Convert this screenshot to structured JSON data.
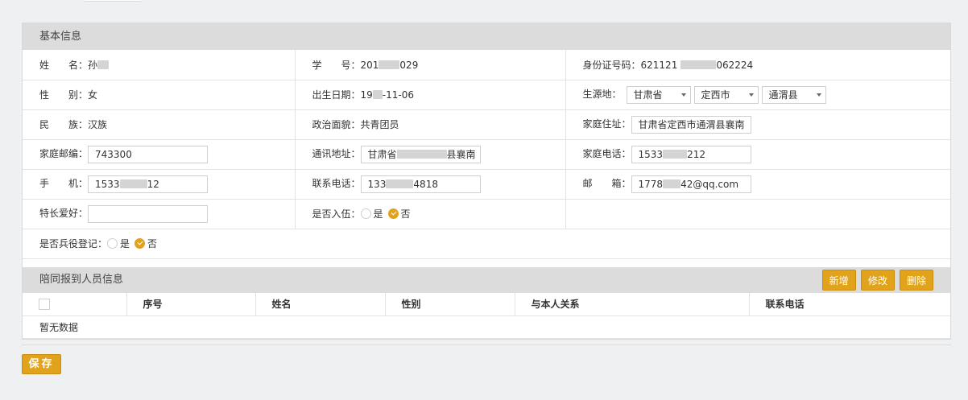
{
  "basic": {
    "title": "基本信息",
    "name_label": "姓　　名：",
    "name_value": "孙",
    "student_id_label": "学　　号：",
    "student_id_prefix": "201",
    "student_id_suffix": "029",
    "id_card_label": "身份证号码：",
    "id_card_prefix": "621121",
    "id_card_suffix": "062224",
    "gender_label": "性　　别：",
    "gender_value": "女",
    "birth_label": "出生日期：",
    "birth_prefix": "19",
    "birth_suffix": "-11-06",
    "origin_label": "生源地：",
    "origin_province": "甘肃省",
    "origin_city": "定西市",
    "origin_county": "通渭县",
    "ethnicity_label": "民　　族：",
    "ethnicity_value": "汉族",
    "political_label": "政治面貌：",
    "political_value": "共青团员",
    "home_address_label": "家庭住址：",
    "home_address_value": "甘肃省定西市通渭县襄南",
    "postcode_label": "家庭邮编：",
    "postcode_value": "743300",
    "mail_address_label": "通讯地址：",
    "mail_address_prefix": "甘肃省",
    "mail_address_suffix": "县襄南",
    "home_phone_label": "家庭电话：",
    "home_phone_prefix": "1533",
    "home_phone_suffix": "212",
    "mobile_label": "手　　机：",
    "mobile_prefix": "1533",
    "mobile_suffix": "12",
    "contact_phone_label": "联系电话：",
    "contact_phone_prefix": "133",
    "contact_phone_suffix": "4818",
    "email_label": "邮　　箱：",
    "email_prefix": "1778",
    "email_suffix": "42@qq.com",
    "hobby_label": "特长爱好：",
    "hobby_value": "",
    "enlisted_label": "是否入伍：",
    "military_reg_label": "是否兵役登记：",
    "yes": "是",
    "no": "否"
  },
  "companions": {
    "title": "陪同报到人员信息",
    "add_label": "新增",
    "edit_label": "修改",
    "delete_label": "删除",
    "columns": [
      "序号",
      "姓名",
      "性别",
      "与本人关系",
      "联系电话"
    ],
    "empty_text": "暂无数据"
  },
  "save_label": "保存",
  "colors": {
    "accent": "#e0a31b",
    "header_bg": "#dcdcdc"
  }
}
